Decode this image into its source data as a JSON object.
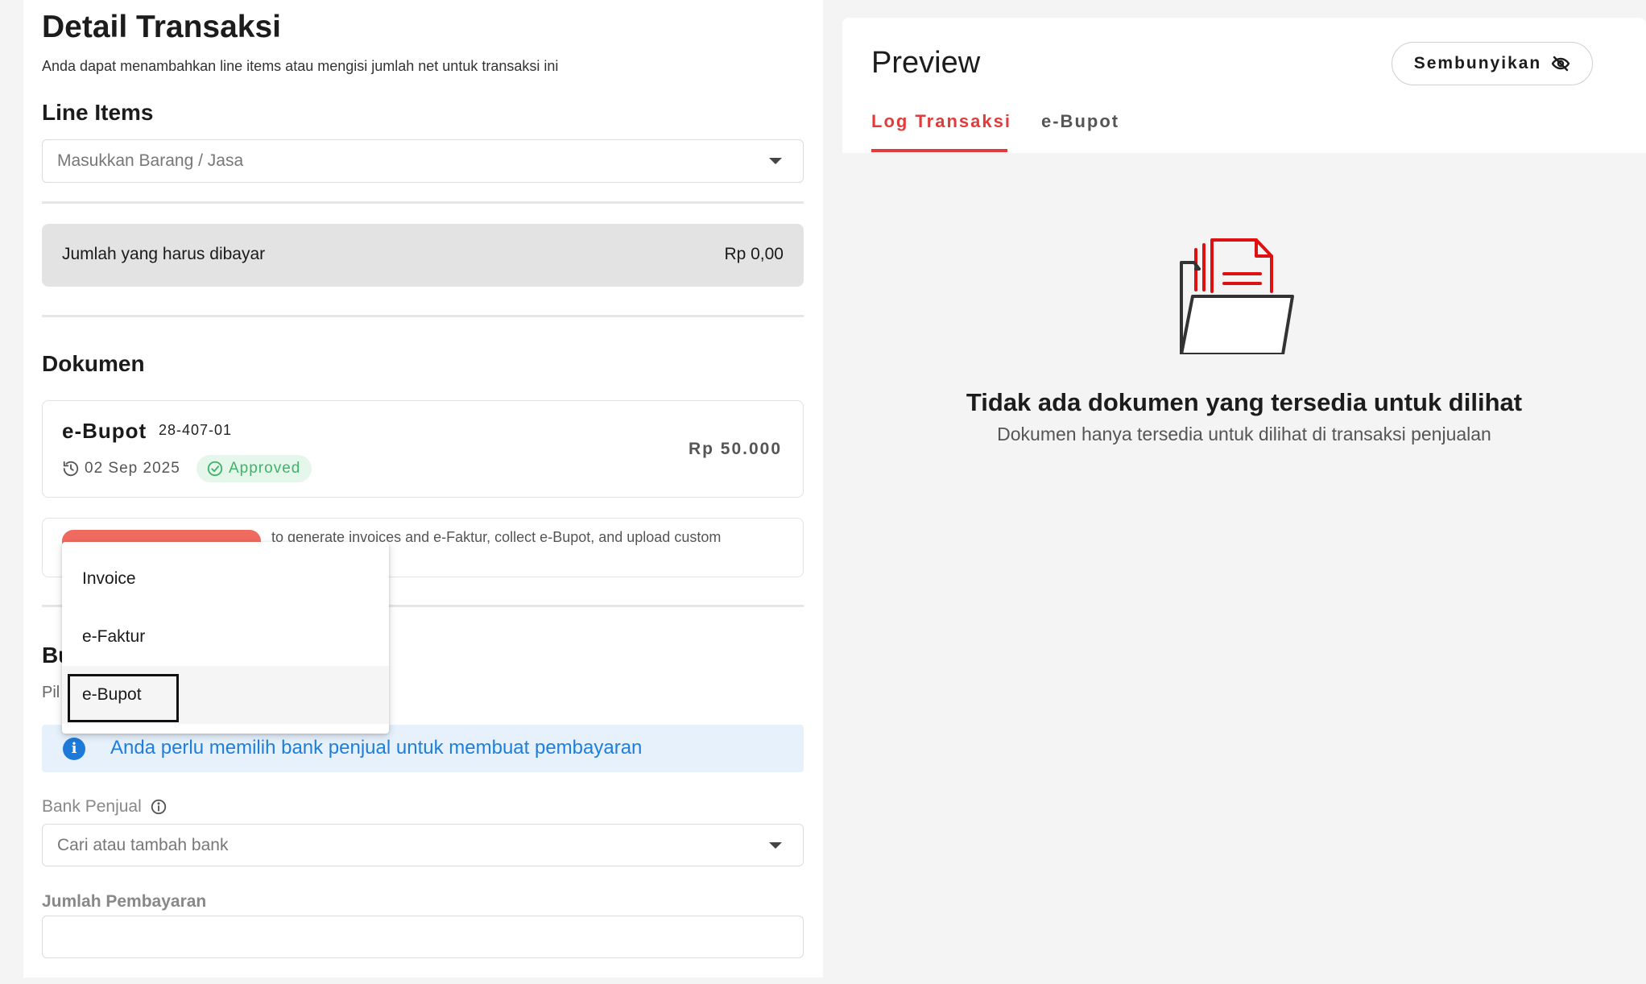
{
  "detail": {
    "title": "Detail Transaksi",
    "subtitle": "Anda dapat menambahkan line items atau mengisi jumlah net untuk transaksi ini",
    "line_items_heading": "Line Items",
    "line_items_placeholder": "Masukkan Barang / Jasa",
    "total_label": "Jumlah yang harus dibayar",
    "total_value": "Rp 0,00"
  },
  "dokumen": {
    "heading": "Dokumen",
    "card": {
      "name": "e-Bupot",
      "number": "28-407-01",
      "date": "02 Sep 2025",
      "status": "Approved",
      "amount": "Rp 50.000"
    },
    "add_description": "to generate invoices and e-Faktur, collect e-Bupot, and upload custom"
  },
  "dropdown_menu": {
    "items": [
      {
        "label": "Invoice"
      },
      {
        "label": "e-Faktur"
      },
      {
        "label": "e-Bupot"
      }
    ],
    "selected": "e-Bupot"
  },
  "pembayaran": {
    "heading_partial": "Bu",
    "sub_partial": "Pil",
    "info_text": "Anda perlu memilih bank penjual untuk membuat pembayaran",
    "bank_label": "Bank Penjual",
    "bank_placeholder": "Cari atau tambah bank",
    "amount_label": "Jumlah Pembayaran"
  },
  "preview": {
    "title": "Preview",
    "hide_button": "Sembunyikan",
    "tabs": [
      {
        "label": "Log Transaksi",
        "active": true
      },
      {
        "label": "e-Bupot",
        "active": false
      }
    ],
    "empty_title": "Tidak ada dokumen yang tersedia untuk dilihat",
    "empty_subtitle": "Dokumen hanya tersedia untuk dilihat di transaksi penjualan"
  },
  "colors": {
    "accent": "#e23b3b",
    "info_blue": "#1f7ed9",
    "approved_green": "#3fb36a"
  },
  "icons": {
    "line_items_caret": "chevron-down-icon",
    "history": "history-icon",
    "approved": "check-circle-icon",
    "info": "info-icon",
    "bank_info": "info-outline-icon",
    "hide": "eye-slash-icon",
    "empty": "folder-document-icon"
  }
}
